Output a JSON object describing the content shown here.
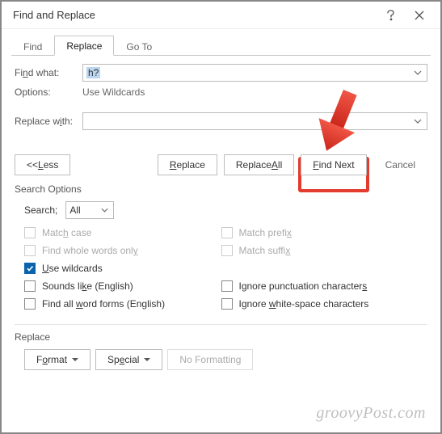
{
  "titlebar": {
    "title": "Find and Replace"
  },
  "tabs": {
    "find": "Find",
    "replace": "Replace",
    "goto": "Go To"
  },
  "form": {
    "find_label_pre": "Fi",
    "find_label_u": "n",
    "find_label_post": "d what:",
    "find_value": "h?",
    "options_label": "Options:",
    "options_value": "Use Wildcards",
    "replace_label_pre": "Replace w",
    "replace_label_u": "i",
    "replace_label_post": "th:",
    "replace_value": ""
  },
  "buttons": {
    "less": "<< Less",
    "less_u": "L",
    "replace": "Replace",
    "replace_u": "R",
    "replace_all": "Replace All",
    "replace_all_u": "A",
    "find_next": "Find Next",
    "find_next_u": "F",
    "cancel": "Cancel"
  },
  "search_options": {
    "title": "Search Options",
    "search_label": "Search",
    "search_label_after": ";",
    "search_value": "All",
    "match_case": "Match case",
    "match_case_u": "H",
    "whole_words": "Find whole words only",
    "whole_words_u": "Y",
    "use_wildcards": "se wildcards",
    "use_wildcards_u": "U",
    "sounds_like": "Sounds li",
    "sounds_like_u": "k",
    "sounds_like_post": "e (English)",
    "word_forms": "Find all ",
    "word_forms_u": "w",
    "word_forms_post": "ord forms (English)",
    "match_prefix": "Match prefix",
    "match_prefix_after": "",
    "match_suffix": "Match suffix",
    "ignore_punct_pre": "Ignore punctuation character",
    "ignore_punct_u": "s",
    "ignore_ws_pre": "Ignore ",
    "ignore_ws_u": "w",
    "ignore_ws_post": "hite-space characters"
  },
  "replace_section": {
    "title": "Replace",
    "format": "Format",
    "format_u": "o",
    "special": "Special",
    "special_u": "e",
    "no_formatting": "No Formatting"
  },
  "watermark": "groovyPost.com"
}
